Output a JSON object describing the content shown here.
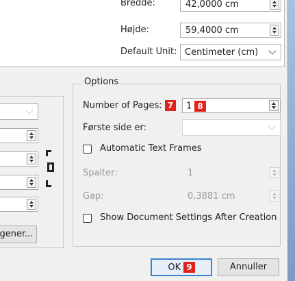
{
  "page_size": {
    "partial_label": "Bredde:",
    "partial_value": "42,0000 cm",
    "height_label": "Højde:",
    "height_value": "59,4000 cm",
    "default_unit_label": "Default Unit:",
    "default_unit_value": "Centimeter (cm)"
  },
  "options": {
    "legend": "Options",
    "number_of_pages_label": "Number of Pages:",
    "number_of_pages_badge": "7",
    "number_of_pages_value": "1",
    "number_of_pages_value_badge": "8",
    "first_page_label": "Første side er:",
    "first_page_value": "",
    "automatic_text_frames_label": "Automatic Text Frames",
    "automatic_text_frames_checked": false,
    "columns_label": "Spalter:",
    "columns_value": "1",
    "gap_label": "Gap:",
    "gap_value": "0,3881 cm",
    "show_settings_label": "Show Document Settings After Creation",
    "show_settings_checked": false
  },
  "left_panel": {
    "button_partial_label": "gener..."
  },
  "footer": {
    "ok_label": "OK",
    "ok_badge": "9",
    "cancel_label": "Annuller"
  }
}
